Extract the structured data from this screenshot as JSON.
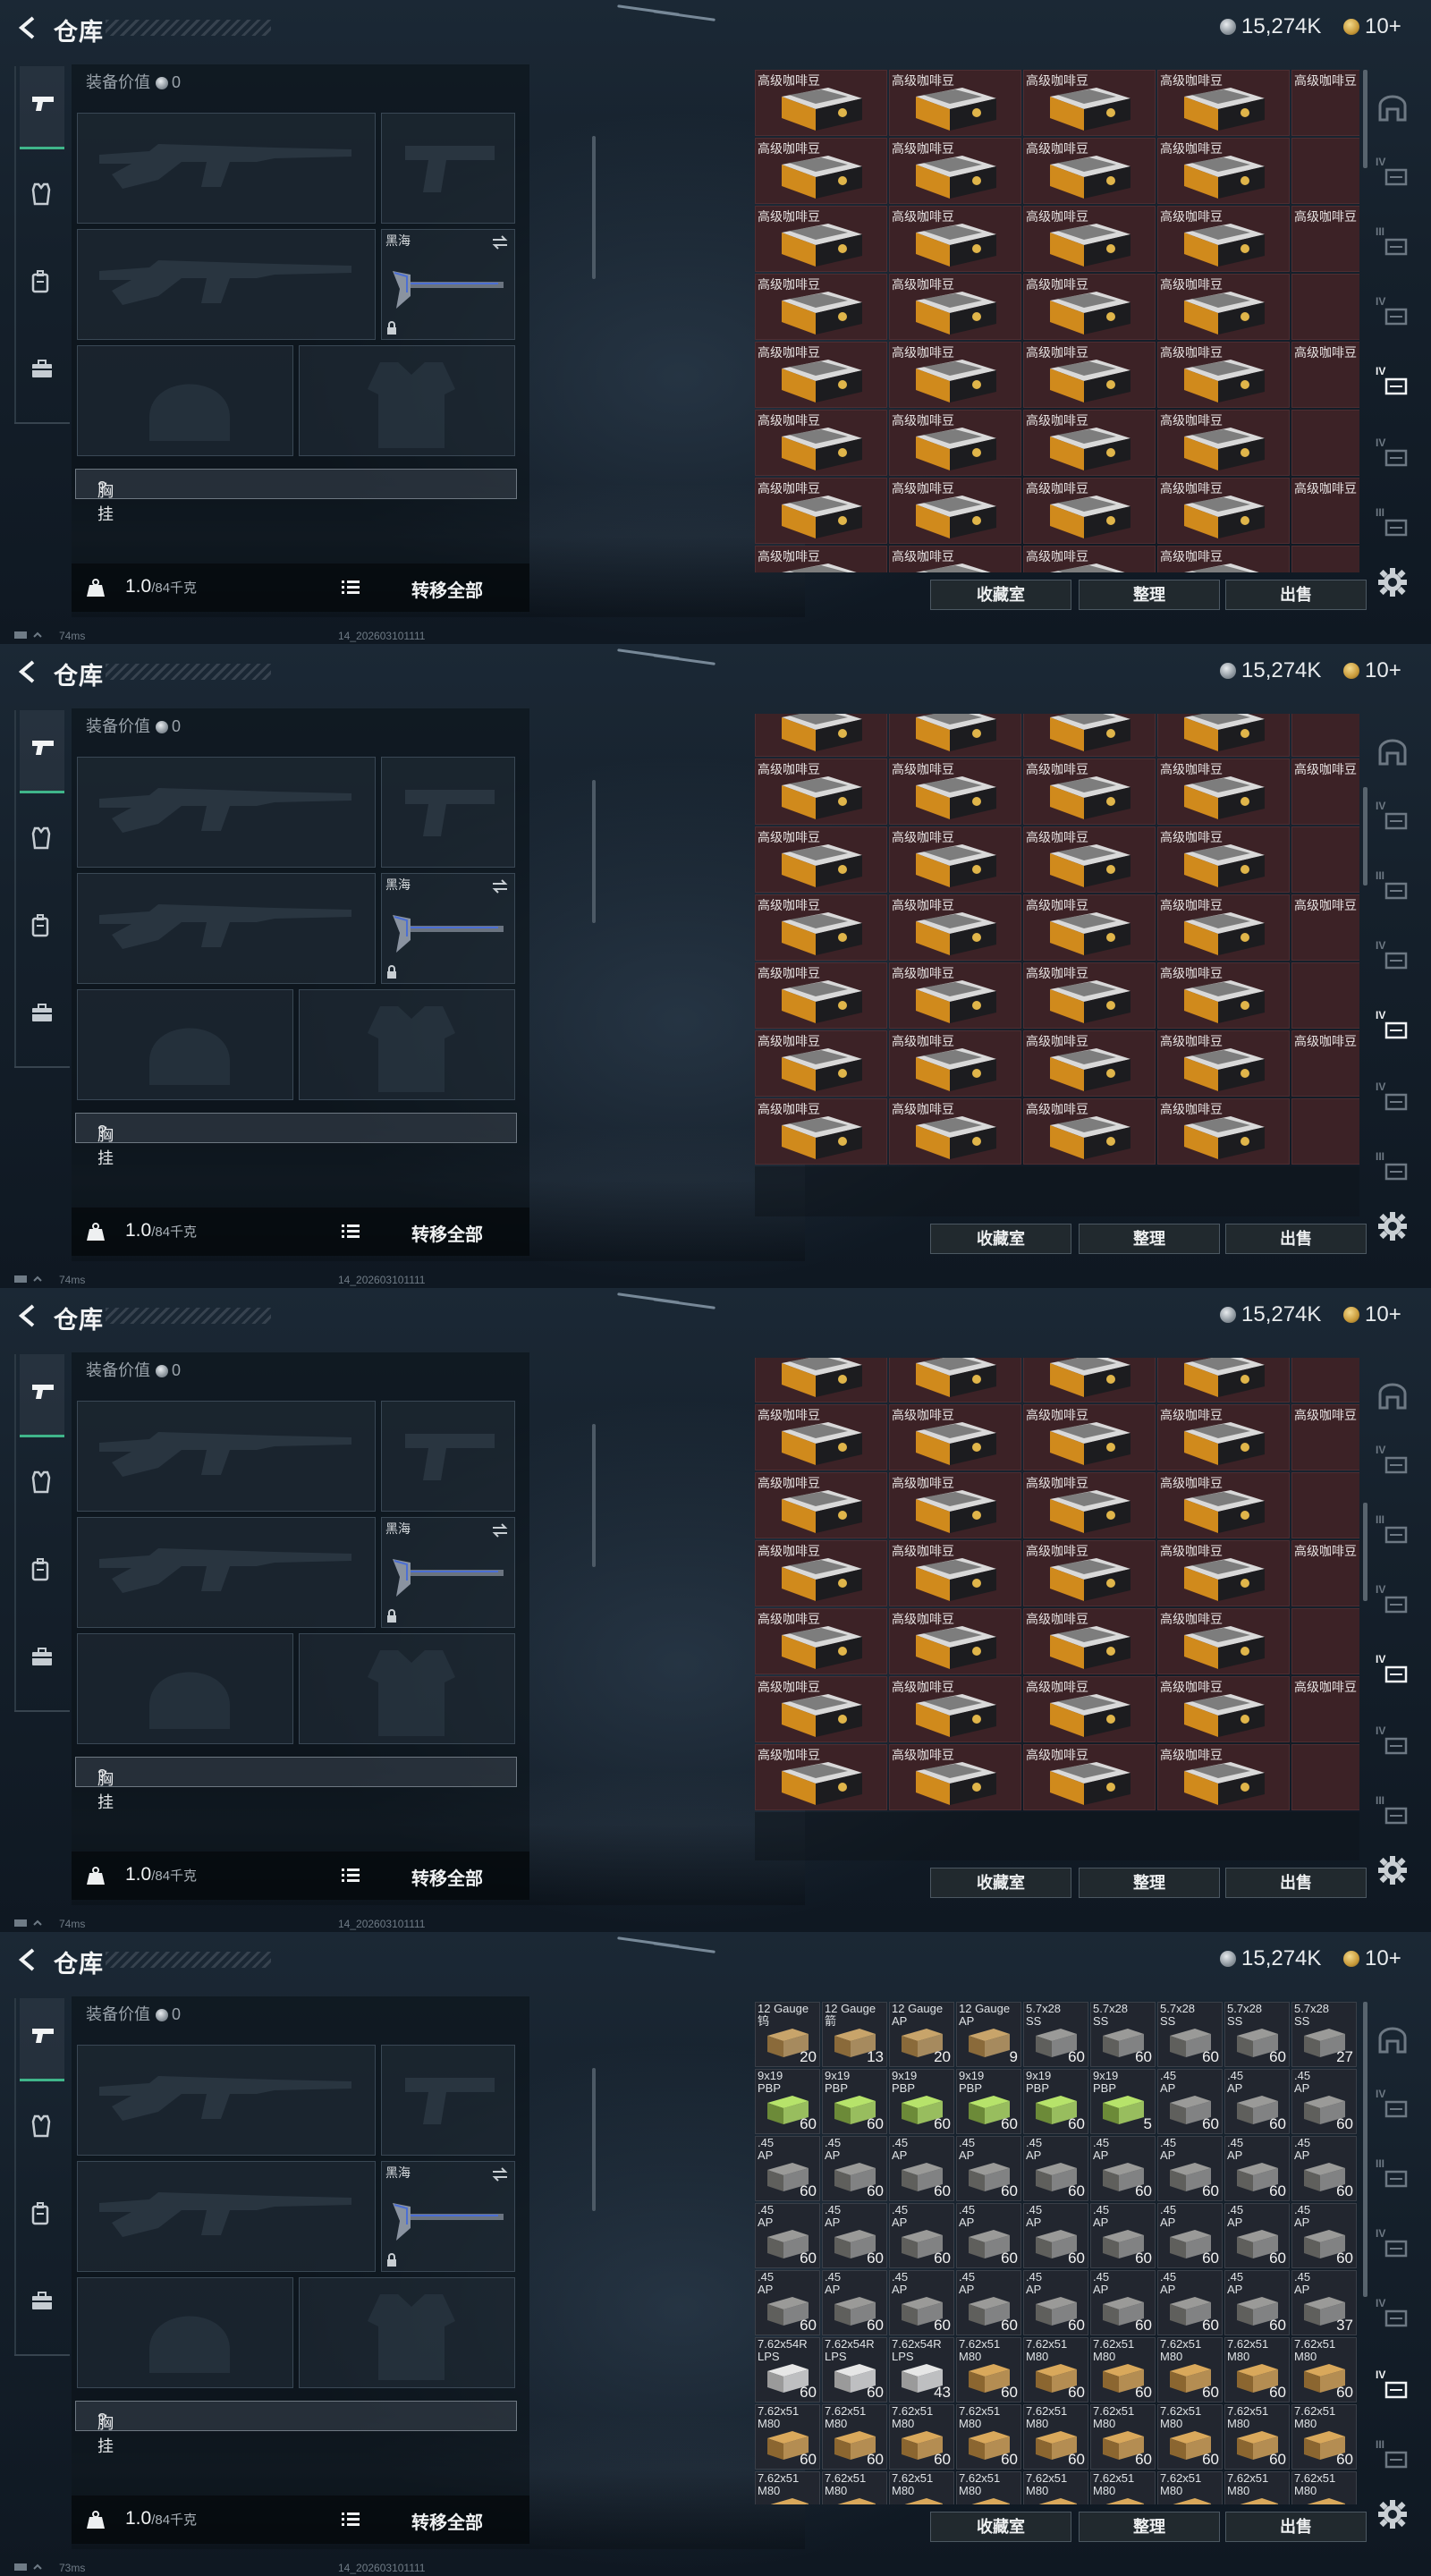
{
  "panels": [
    {
      "topbar": {
        "title": "仓库",
        "silver": "15,274K",
        "gold": "10+"
      },
      "equipment": {
        "value_label": "装备价值",
        "value": "0",
        "slot_name": "黑海",
        "chest_label": "胸挂",
        "chest_hint": "?",
        "weight": "1.0",
        "weight_max": "/84千克",
        "transfer_label": "转移全部"
      },
      "status": {
        "ping": "74ms",
        "build": "14_202603101111"
      },
      "buttons": {
        "vault": "收藏室",
        "sort": "整理",
        "sell": "出售"
      }
    },
    {
      "topbar": {
        "title": "仓库",
        "silver": "15,274K",
        "gold": "10+"
      },
      "equipment": {
        "value_label": "装备价值",
        "value": "0",
        "slot_name": "黑海",
        "chest_label": "胸挂",
        "chest_hint": "?",
        "weight": "1.0",
        "weight_max": "/84千克",
        "transfer_label": "转移全部"
      },
      "status": {
        "ping": "74ms",
        "build": "14_202603101111"
      },
      "buttons": {
        "vault": "收藏室",
        "sort": "整理",
        "sell": "出售"
      }
    },
    {
      "topbar": {
        "title": "仓库",
        "silver": "15,274K",
        "gold": "10+"
      },
      "equipment": {
        "value_label": "装备价值",
        "value": "0",
        "slot_name": "黑海",
        "chest_label": "胸挂",
        "chest_hint": "?",
        "weight": "1.0",
        "weight_max": "/84千克",
        "transfer_label": "转移全部"
      },
      "status": {
        "ping": "74ms",
        "build": "14_202603101111"
      },
      "buttons": {
        "vault": "收藏室",
        "sort": "整理",
        "sell": "出售"
      }
    },
    {
      "topbar": {
        "title": "仓库",
        "silver": "15,274K",
        "gold": "10+"
      },
      "equipment": {
        "value_label": "装备价值",
        "value": "0",
        "slot_name": "黑海",
        "chest_label": "胸挂",
        "chest_hint": "?",
        "weight": "1.0",
        "weight_max": "/84千克",
        "transfer_label": "转移全部"
      },
      "status": {
        "ping": "73ms",
        "build": "14_202603101111"
      },
      "buttons": {
        "vault": "收藏室",
        "sort": "整理",
        "sell": "出售"
      }
    }
  ],
  "coffee_item": {
    "name": "高级咖啡豆",
    "icon": "coffee-bag-icon"
  },
  "ammo_rows": [
    [
      {
        "name": "12 Gauge\n钨",
        "count": "20",
        "kind": "shell"
      },
      {
        "name": "12 Gauge\n箭",
        "count": "13",
        "kind": "shell"
      },
      {
        "name": "12 Gauge\nAP",
        "count": "20",
        "kind": "shell"
      },
      {
        "name": "12 Gauge\nAP",
        "count": "9",
        "kind": "shell"
      },
      {
        "name": "5.7x28\nSS",
        "count": "60",
        "kind": "box"
      },
      {
        "name": "5.7x28\nSS",
        "count": "60",
        "kind": "box"
      },
      {
        "name": "5.7x28\nSS",
        "count": "60",
        "kind": "box"
      },
      {
        "name": "5.7x28\nSS",
        "count": "60",
        "kind": "box"
      },
      {
        "name": "5.7x28\nSS",
        "count": "27",
        "kind": "box"
      }
    ],
    [
      {
        "name": "9x19\nPBP",
        "count": "60",
        "kind": "green"
      },
      {
        "name": "9x19\nPBP",
        "count": "60",
        "kind": "green"
      },
      {
        "name": "9x19\nPBP",
        "count": "60",
        "kind": "green"
      },
      {
        "name": "9x19\nPBP",
        "count": "60",
        "kind": "green"
      },
      {
        "name": "9x19\nPBP",
        "count": "60",
        "kind": "green"
      },
      {
        "name": "9x19\nPBP",
        "count": "5",
        "kind": "green"
      },
      {
        "name": ".45\nAP",
        "count": "60",
        "kind": "box"
      },
      {
        "name": ".45\nAP",
        "count": "60",
        "kind": "box"
      },
      {
        "name": ".45\nAP",
        "count": "60",
        "kind": "box"
      }
    ],
    [
      {
        "name": ".45\nAP",
        "count": "60",
        "kind": "box"
      },
      {
        "name": ".45\nAP",
        "count": "60",
        "kind": "box"
      },
      {
        "name": ".45\nAP",
        "count": "60",
        "kind": "box"
      },
      {
        "name": ".45\nAP",
        "count": "60",
        "kind": "box"
      },
      {
        "name": ".45\nAP",
        "count": "60",
        "kind": "box"
      },
      {
        "name": ".45\nAP",
        "count": "60",
        "kind": "box"
      },
      {
        "name": ".45\nAP",
        "count": "60",
        "kind": "box"
      },
      {
        "name": ".45\nAP",
        "count": "60",
        "kind": "box"
      },
      {
        "name": ".45\nAP",
        "count": "60",
        "kind": "box"
      }
    ],
    [
      {
        "name": ".45\nAP",
        "count": "60",
        "kind": "box"
      },
      {
        "name": ".45\nAP",
        "count": "60",
        "kind": "box"
      },
      {
        "name": ".45\nAP",
        "count": "60",
        "kind": "box"
      },
      {
        "name": ".45\nAP",
        "count": "60",
        "kind": "box"
      },
      {
        "name": ".45\nAP",
        "count": "60",
        "kind": "box"
      },
      {
        "name": ".45\nAP",
        "count": "60",
        "kind": "box"
      },
      {
        "name": ".45\nAP",
        "count": "60",
        "kind": "box"
      },
      {
        "name": ".45\nAP",
        "count": "60",
        "kind": "box"
      },
      {
        "name": ".45\nAP",
        "count": "60",
        "kind": "box"
      }
    ],
    [
      {
        "name": ".45\nAP",
        "count": "60",
        "kind": "box"
      },
      {
        "name": ".45\nAP",
        "count": "60",
        "kind": "box"
      },
      {
        "name": ".45\nAP",
        "count": "60",
        "kind": "box"
      },
      {
        "name": ".45\nAP",
        "count": "60",
        "kind": "box"
      },
      {
        "name": ".45\nAP",
        "count": "60",
        "kind": "box"
      },
      {
        "name": ".45\nAP",
        "count": "60",
        "kind": "box"
      },
      {
        "name": ".45\nAP",
        "count": "60",
        "kind": "box"
      },
      {
        "name": ".45\nAP",
        "count": "60",
        "kind": "box"
      },
      {
        "name": ".45\nAP",
        "count": "37",
        "kind": "box"
      }
    ],
    [
      {
        "name": "7.62x54R\nLPS",
        "count": "60",
        "kind": "white"
      },
      {
        "name": "7.62x54R\nLPS",
        "count": "60",
        "kind": "white"
      },
      {
        "name": "7.62x54R\nLPS",
        "count": "43",
        "kind": "white"
      },
      {
        "name": "7.62x51\nM80",
        "count": "60",
        "kind": "tan"
      },
      {
        "name": "7.62x51\nM80",
        "count": "60",
        "kind": "tan"
      },
      {
        "name": "7.62x51\nM80",
        "count": "60",
        "kind": "tan"
      },
      {
        "name": "7.62x51\nM80",
        "count": "60",
        "kind": "tan"
      },
      {
        "name": "7.62x51\nM80",
        "count": "60",
        "kind": "tan"
      },
      {
        "name": "7.62x51\nM80",
        "count": "60",
        "kind": "tan"
      }
    ],
    [
      {
        "name": "7.62x51\nM80",
        "count": "60",
        "kind": "tan"
      },
      {
        "name": "7.62x51\nM80",
        "count": "60",
        "kind": "tan"
      },
      {
        "name": "7.62x51\nM80",
        "count": "60",
        "kind": "tan"
      },
      {
        "name": "7.62x51\nM80",
        "count": "60",
        "kind": "tan"
      },
      {
        "name": "7.62x51\nM80",
        "count": "60",
        "kind": "tan"
      },
      {
        "name": "7.62x51\nM80",
        "count": "60",
        "kind": "tan"
      },
      {
        "name": "7.62x51\nM80",
        "count": "60",
        "kind": "tan"
      },
      {
        "name": "7.62x51\nM80",
        "count": "60",
        "kind": "tan"
      },
      {
        "name": "7.62x51\nM80",
        "count": "60",
        "kind": "tan"
      }
    ],
    [
      {
        "name": "7.62x51\nM80",
        "count": "",
        "kind": "tan"
      },
      {
        "name": "7.62x51\nM80",
        "count": "",
        "kind": "tan"
      },
      {
        "name": "7.62x51\nM80",
        "count": "",
        "kind": "tan"
      },
      {
        "name": "7.62x51\nM80",
        "count": "",
        "kind": "tan"
      },
      {
        "name": "7.62x51\nM80",
        "count": "",
        "kind": "tan"
      },
      {
        "name": "7.62x51\nM80",
        "count": "",
        "kind": "tan"
      },
      {
        "name": "7.62x51\nM80",
        "count": "",
        "kind": "tan"
      },
      {
        "name": "7.62x51\nM80",
        "count": "",
        "kind": "tan"
      },
      {
        "name": "7.62x51\nM80",
        "count": "",
        "kind": "tan"
      }
    ]
  ],
  "right_rail_labels": [
    "",
    "IV",
    "III",
    "IV",
    "IV",
    "IV",
    "III"
  ],
  "colors": {
    "accent": "#3fb58a",
    "coffee_cell": "#3c2226",
    "ammo_cell": "#22262f"
  }
}
